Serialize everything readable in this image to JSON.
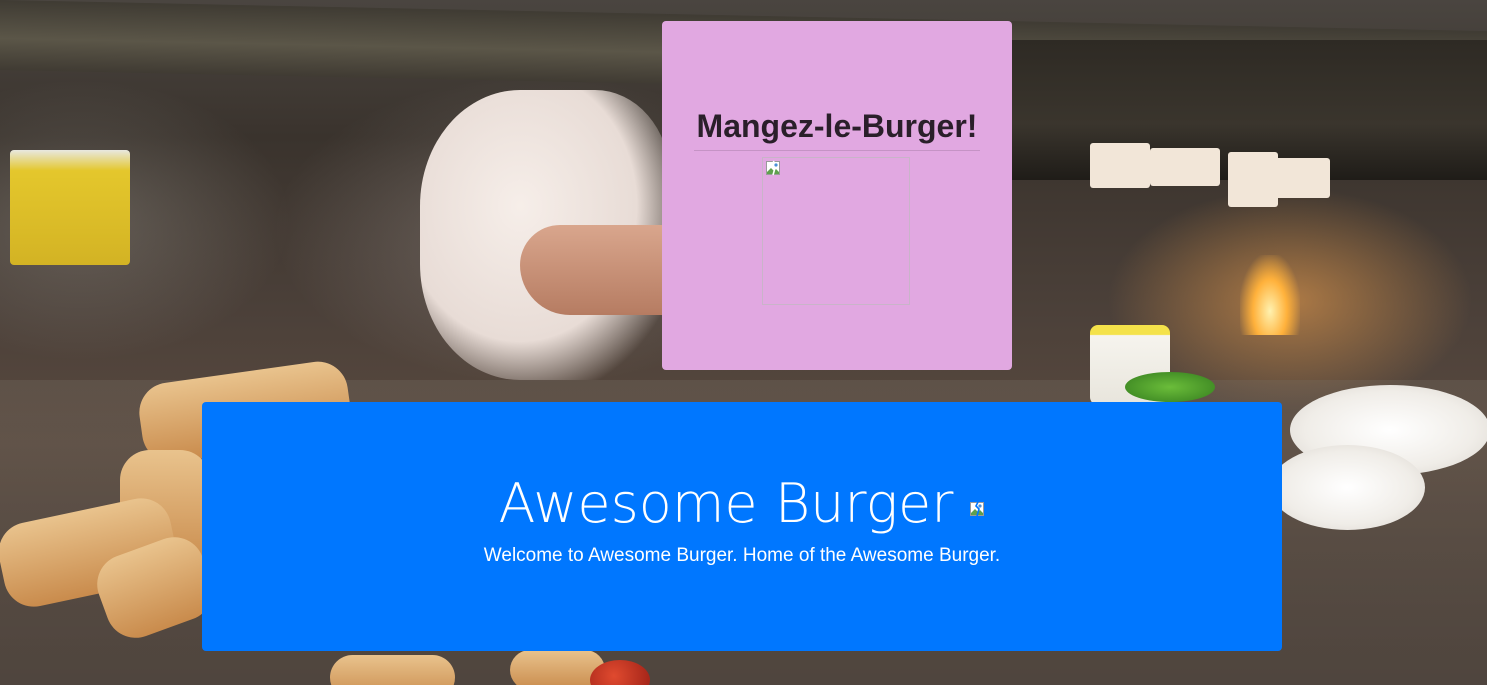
{
  "brand": {
    "title": "Mangez-le-Burger!",
    "logo_icon": "broken-image-icon"
  },
  "jumbotron": {
    "heading": "Awesome Burger",
    "heading_icon": "broken-image-icon",
    "lead": "Welcome to Awesome Burger. Home of the Awesome Burger.",
    "background_color": "#0077ff"
  },
  "colors": {
    "title_card": "#e1a8e1",
    "jumbotron": "#0077ff",
    "jumbotron_text": "#ffffff"
  },
  "background": {
    "icon": "kitchen-photo"
  }
}
